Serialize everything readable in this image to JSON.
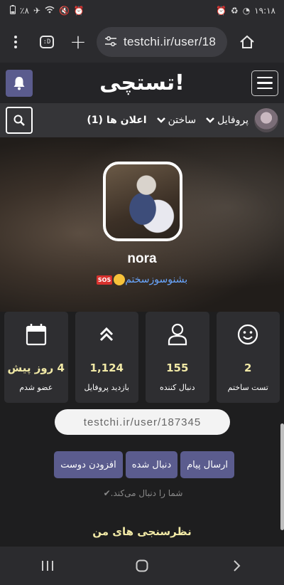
{
  "status_bar": {
    "left_text": "٪۸",
    "time": "۱۹:۱۸"
  },
  "browser": {
    "tab_label": ":D",
    "url": "testchi.ir/user/18"
  },
  "site": {
    "logo": "تستچی!"
  },
  "nav": {
    "profile": "پروفایل",
    "create": "ساختن",
    "notifications": "اعلان ها (1)"
  },
  "profile": {
    "username": "nora",
    "bio": "بشنوسوزسختم",
    "bio_badge": "SOS"
  },
  "stats": [
    {
      "icon": "smile-icon",
      "value": "2",
      "label": "تست ساختم"
    },
    {
      "icon": "user-icon",
      "value": "155",
      "label": "دنبال کننده"
    },
    {
      "icon": "chevrons-up-icon",
      "value": "1,124",
      "label": "بازدید پروفایل"
    },
    {
      "icon": "calendar-icon",
      "value": "4 روز پیش",
      "label": "عضو شدم"
    }
  ],
  "profile_url": "testchi.ir/user/187345",
  "actions": {
    "message": "ارسال پیام",
    "following": "دنبال شده",
    "add_friend": "افزودن دوست"
  },
  "follow_note": "شما را دنبال می‌کند.",
  "polls_title": "نظرسنجی های من",
  "colors": {
    "accent": "#5b5c8e",
    "stat_value": "#f1e9a6",
    "bio_link": "#6aa7ff"
  }
}
